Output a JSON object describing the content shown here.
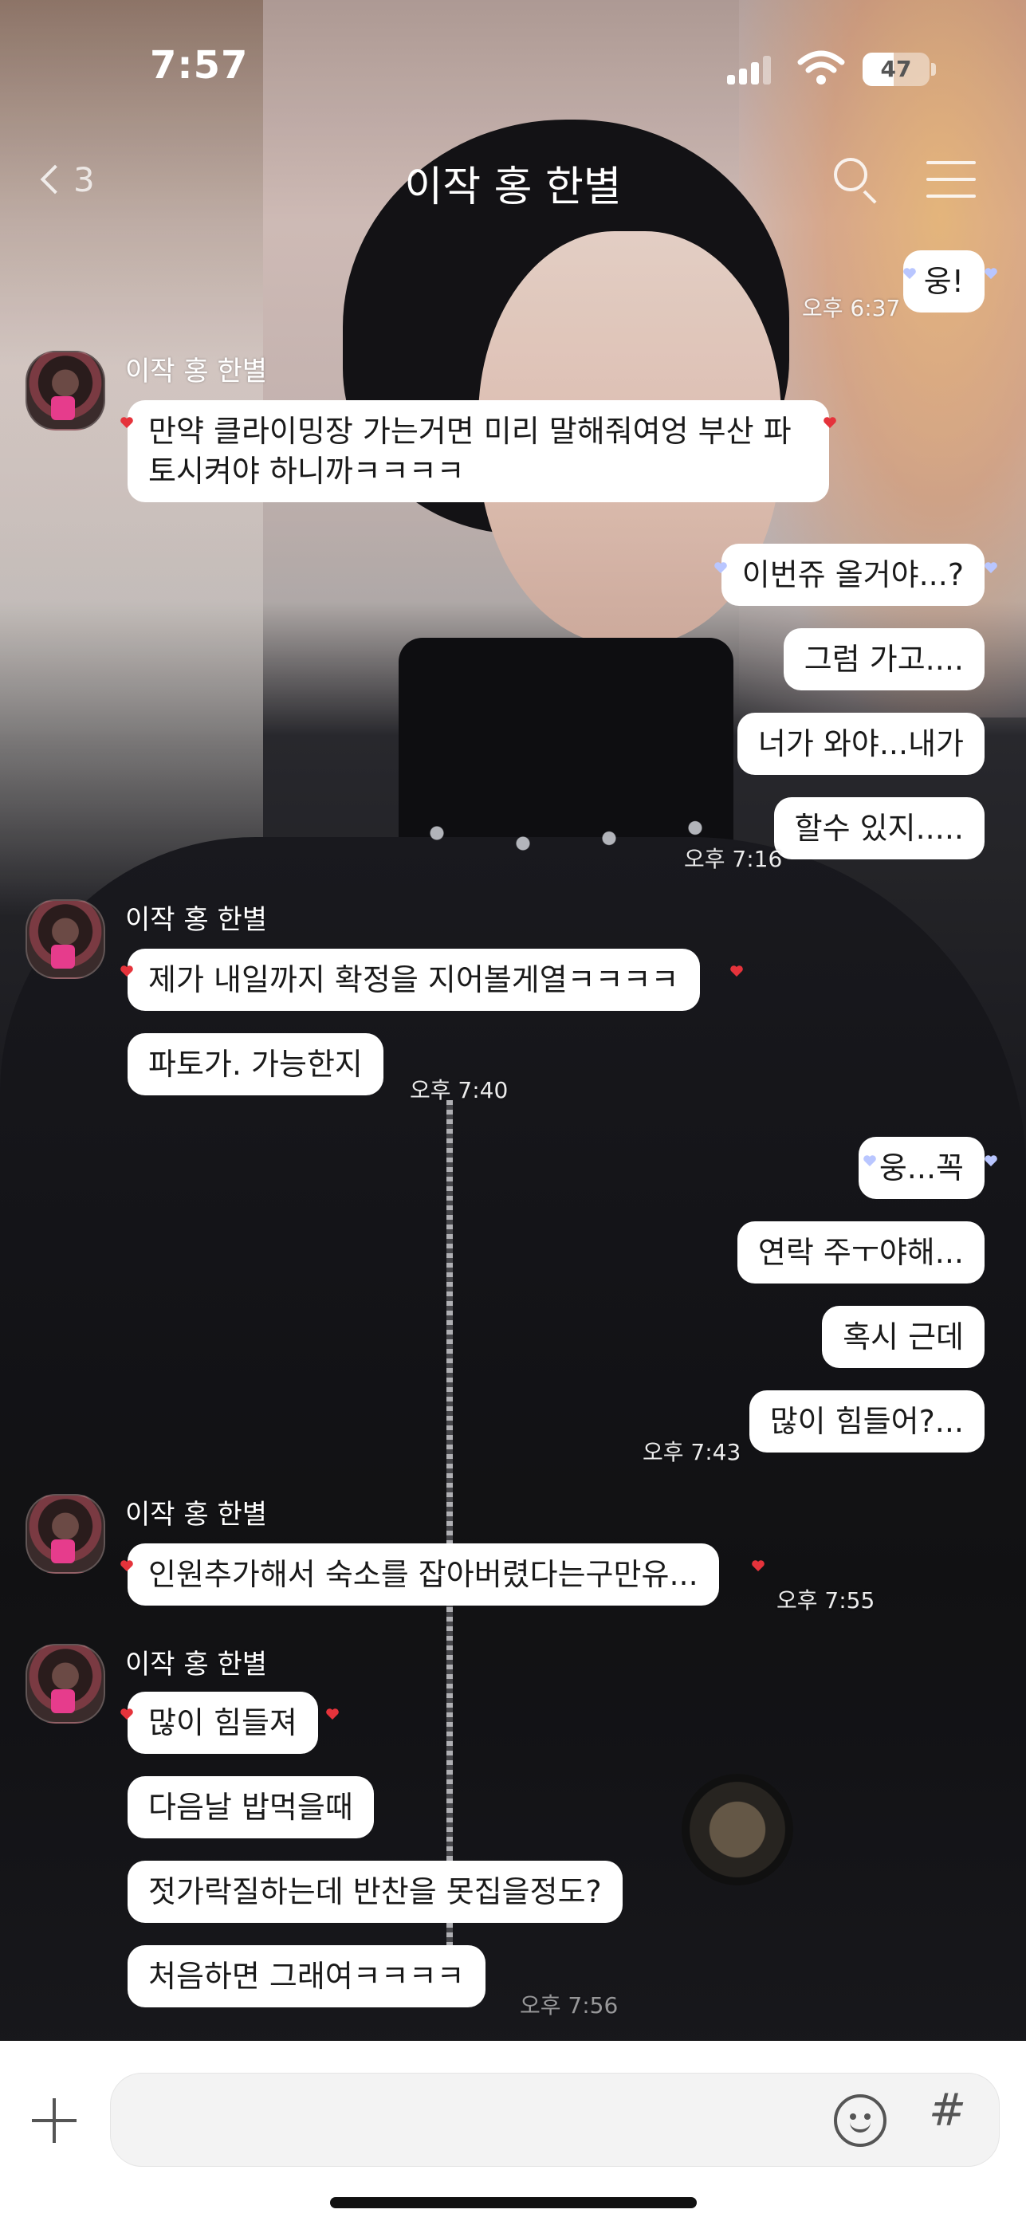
{
  "status_bar": {
    "time": "7:57",
    "battery": "47",
    "battery_level": 0.47
  },
  "header": {
    "back_count": "3",
    "title": "이작 홍 한별"
  },
  "chat": {
    "sender": "이작 홍 한별",
    "messages": [
      {
        "from": "me",
        "text": "웅!"
      },
      {
        "from": "me",
        "time": "오후 6:37"
      },
      {
        "from": "other",
        "text": "만약 클라이밍장 가는거면 미리 말해줘여엉 부산 파토시켜야 하니까ㅋㅋㅋㅋ"
      },
      {
        "from": "me",
        "text": "이번쥬 올거야...?"
      },
      {
        "from": "me",
        "text": "그럼 가고...."
      },
      {
        "from": "me",
        "text": "너가 와야...내가"
      },
      {
        "from": "me",
        "text": "할수 있지....."
      },
      {
        "from": "me",
        "time": "오후 7:16"
      },
      {
        "from": "other",
        "text": "제가 내일까지 확정을 지어볼게열ㅋㅋㅋㅋ"
      },
      {
        "from": "other",
        "text": "파토가. 가능한지"
      },
      {
        "from": "other",
        "time": "오후 7:40"
      },
      {
        "from": "me",
        "text": "웅...꼭"
      },
      {
        "from": "me",
        "text": "연락 주ㅜ야해..."
      },
      {
        "from": "me",
        "text": "혹시 근데"
      },
      {
        "from": "me",
        "text": "많이 힘들어?..."
      },
      {
        "from": "me",
        "time": "오후 7:43"
      },
      {
        "from": "other",
        "text": "인원추가해서 숙소를 잡아버렸다는구만유..."
      },
      {
        "from": "other",
        "time": "오후 7:55"
      },
      {
        "from": "other",
        "text": "많이 힘들져"
      },
      {
        "from": "other",
        "text": "다음날 밥먹을때"
      },
      {
        "from": "other",
        "text": "젓가락질하는데 반찬을 못집을정도?"
      },
      {
        "from": "other",
        "text": "처음하면 그래여ㅋㅋㅋㅋ"
      },
      {
        "from": "other",
        "time": "오후 7:56"
      }
    ]
  },
  "input_bar": {
    "placeholder": "",
    "hash_label": "#"
  },
  "colors": {
    "bubble": "#ffffff",
    "heart_other": "#e5333b",
    "heart_me": "#b9c6ff",
    "input_bar": "#ffffff"
  },
  "icons": [
    "back-chevron-icon",
    "search-icon",
    "menu-icon",
    "plus-icon",
    "emoji-icon",
    "hash-icon",
    "heart-icon",
    "signal-icon",
    "wifi-icon",
    "battery-icon"
  ]
}
